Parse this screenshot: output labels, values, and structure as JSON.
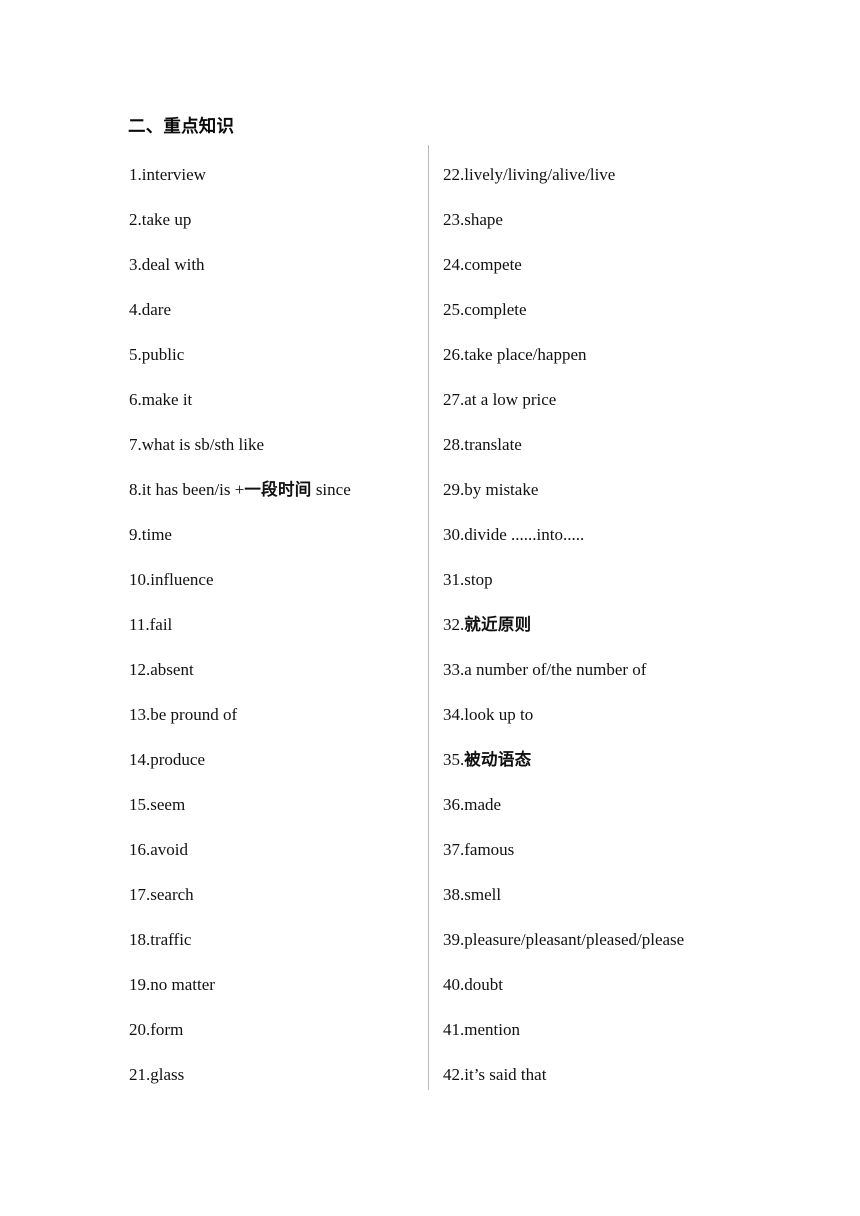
{
  "document": {
    "heading": "二、重点知识",
    "divider_color": "#b9b9b9",
    "text_color": "#111111",
    "background_color": "#ffffff"
  },
  "left_column": {
    "items": [
      {
        "number": "1.",
        "text": "interview"
      },
      {
        "number": "2.",
        "text": "take up"
      },
      {
        "number": "3.",
        "text": "deal with"
      },
      {
        "number": "4.",
        "text": "dare"
      },
      {
        "number": "5.",
        "text": "public"
      },
      {
        "number": "6.",
        "text": "make it"
      },
      {
        "number": "7.",
        "text": "what is sb/sth like"
      },
      {
        "number": "8.",
        "text": "it has been/is +一段时间  since",
        "prefix": "it has been/is +",
        "cjk": "一段时间",
        "suffix": "  since"
      },
      {
        "number": "9.",
        "text": "time"
      },
      {
        "number": "10.",
        "text": "influence"
      },
      {
        "number": "11.",
        "text": "fail"
      },
      {
        "number": "12.",
        "text": "absent"
      },
      {
        "number": "13.",
        "text": "be pround of"
      },
      {
        "number": "14.",
        "text": "produce"
      },
      {
        "number": "15.",
        "text": "seem"
      },
      {
        "number": "16.",
        "text": "avoid"
      },
      {
        "number": "17.",
        "text": "search"
      },
      {
        "number": "18.",
        "text": "traffic"
      },
      {
        "number": "19.",
        "text": "no matter"
      },
      {
        "number": "20.",
        "text": "form"
      },
      {
        "number": "21.",
        "text": "glass"
      }
    ]
  },
  "right_column": {
    "items": [
      {
        "number": "22.",
        "text": "lively/living/alive/live"
      },
      {
        "number": "23.",
        "text": "shape"
      },
      {
        "number": "24.",
        "text": "compete"
      },
      {
        "number": "25.",
        "text": "complete"
      },
      {
        "number": "26.",
        "text": "take place/happen"
      },
      {
        "number": "27.",
        "text": "at a low price"
      },
      {
        "number": "28.",
        "text": "translate"
      },
      {
        "number": "29.",
        "text": "by mistake"
      },
      {
        "number": "30.",
        "text": "divide ......into....."
      },
      {
        "number": "31.",
        "text": "stop"
      },
      {
        "number": "32.",
        "text": "就近原则",
        "cjk_only": true
      },
      {
        "number": "33.",
        "text": "a number of/the number of"
      },
      {
        "number": "34.",
        "text": "look up to"
      },
      {
        "number": "35.",
        "text": "被动语态",
        "cjk_only": true
      },
      {
        "number": "36.",
        "text": "made"
      },
      {
        "number": "37.",
        "text": "famous"
      },
      {
        "number": "38.",
        "text": "smell"
      },
      {
        "number": "39.",
        "text": "pleasure/pleasant/pleased/please"
      },
      {
        "number": "40.",
        "text": "doubt"
      },
      {
        "number": "41.",
        "text": "mention"
      },
      {
        "number": "42.",
        "text": "it’s said that"
      }
    ]
  }
}
